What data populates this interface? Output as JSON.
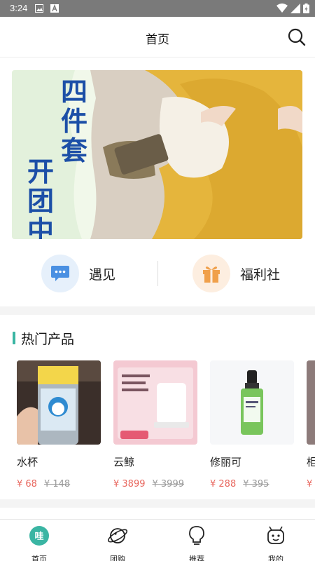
{
  "status_bar": {
    "time": "3:24"
  },
  "header": {
    "title": "首页"
  },
  "banner": {
    "text_line1": "四件套",
    "text_line2": "开团中"
  },
  "quick_entries": [
    {
      "label": "遇见",
      "icon": "chat-bubble-icon",
      "color": "#4a90e2"
    },
    {
      "label": "福利社",
      "icon": "gift-icon",
      "color": "#f0a04b"
    }
  ],
  "hot_products": {
    "title": "热门产品",
    "items": [
      {
        "name": "水杯",
        "price": "¥ 68",
        "old_price": "¥ 148"
      },
      {
        "name": "云鲸",
        "price": "¥ 3899",
        "old_price": "¥ 3999"
      },
      {
        "name": "修丽可",
        "price": "¥ 288",
        "old_price": "¥ 395"
      },
      {
        "name": "柜",
        "price": "¥",
        "old_price": ""
      }
    ]
  },
  "tabs": [
    {
      "label": "首页",
      "icon": "home-icon",
      "active": true
    },
    {
      "label": "团购",
      "icon": "planet-icon",
      "active": false
    },
    {
      "label": "推荐",
      "icon": "lightbulb-icon",
      "active": false
    },
    {
      "label": "我的",
      "icon": "robot-face-icon",
      "active": false
    }
  ],
  "colors": {
    "accent": "#3ab5a3",
    "price": "#e8665d",
    "banner_text": "#1c4fa7"
  }
}
